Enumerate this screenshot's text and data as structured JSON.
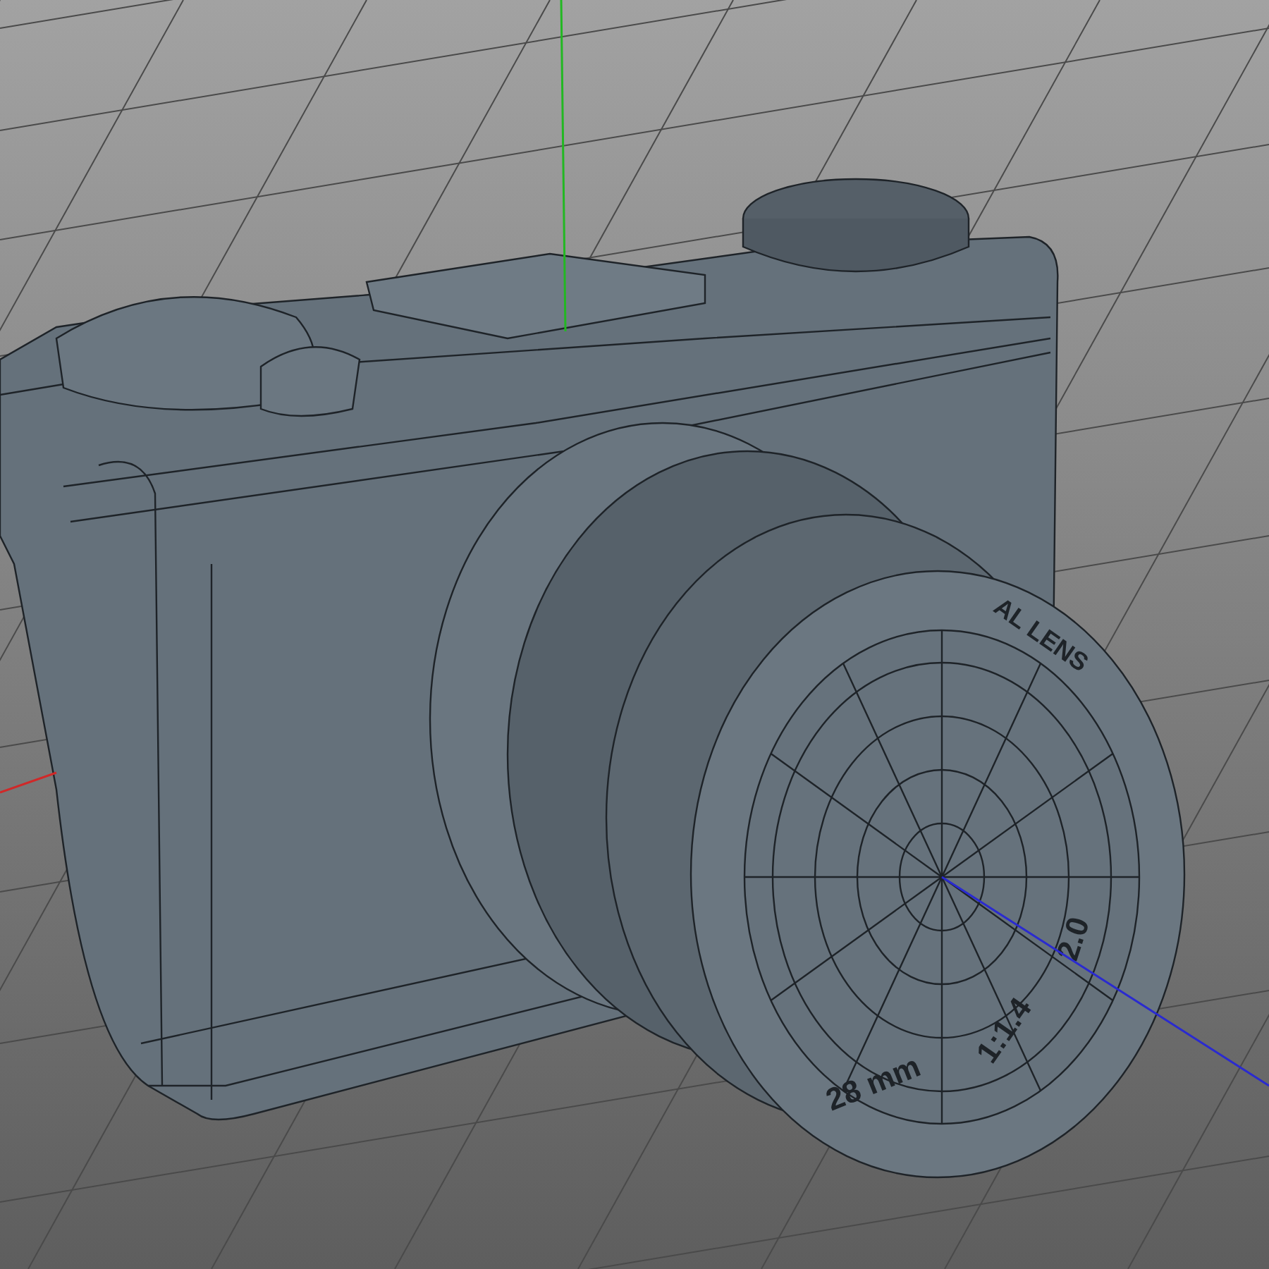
{
  "viewport": {
    "axes": [
      {
        "kind": "x",
        "color": "#d02828"
      },
      {
        "kind": "y",
        "color": "#22b822"
      },
      {
        "kind": "z",
        "color": "#2a2ad0"
      }
    ],
    "lens_markings": [
      {
        "text": "AL LENS"
      },
      {
        "text": "28 mm"
      },
      {
        "text": "1:1.4"
      },
      {
        "text": "2.0"
      }
    ]
  }
}
